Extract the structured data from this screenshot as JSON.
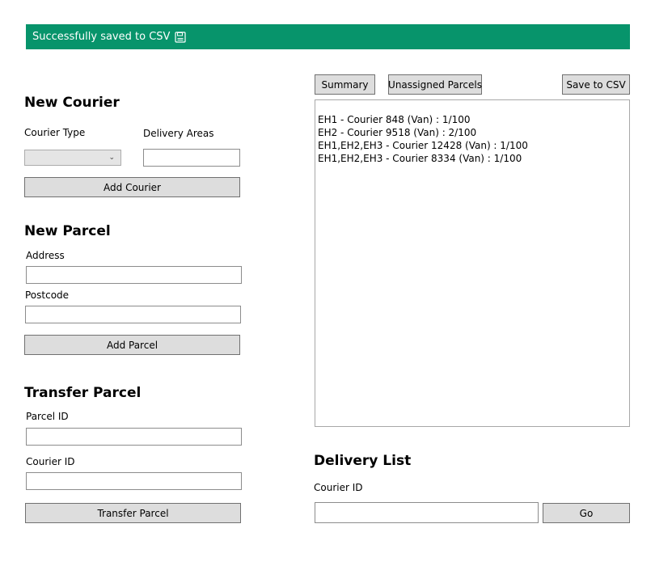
{
  "status": {
    "message": "Successfully saved to CSV",
    "icon": "save-icon",
    "background": "#07946b"
  },
  "new_courier": {
    "title": "New Courier",
    "courier_type_label": "Courier Type",
    "courier_type_value": "",
    "delivery_areas_label": "Delivery Areas",
    "delivery_areas_value": "",
    "add_button": "Add Courier"
  },
  "new_parcel": {
    "title": "New Parcel",
    "address_label": "Address",
    "address_value": "",
    "postcode_label": "Postcode",
    "postcode_value": "",
    "add_button": "Add Parcel"
  },
  "transfer_parcel": {
    "title": "Transfer Parcel",
    "parcel_id_label": "Parcel ID",
    "parcel_id_value": "",
    "courier_id_label": "Courier ID",
    "courier_id_value": "",
    "transfer_button": "Transfer Parcel"
  },
  "toolbar": {
    "summary_button": "Summary",
    "unassigned_button": "Unassigned Parcels",
    "save_button": "Save to CSV"
  },
  "summary_list": {
    "items": [
      "EH1 - Courier 848 (Van) : 1/100",
      "EH2 - Courier 9518 (Van) : 2/100",
      "EH1,EH2,EH3 - Courier 12428 (Van) : 1/100",
      "EH1,EH2,EH3 - Courier 8334 (Van) : 1/100"
    ]
  },
  "delivery_list": {
    "title": "Delivery List",
    "courier_id_label": "Courier ID",
    "courier_id_value": "",
    "go_button": "Go"
  }
}
